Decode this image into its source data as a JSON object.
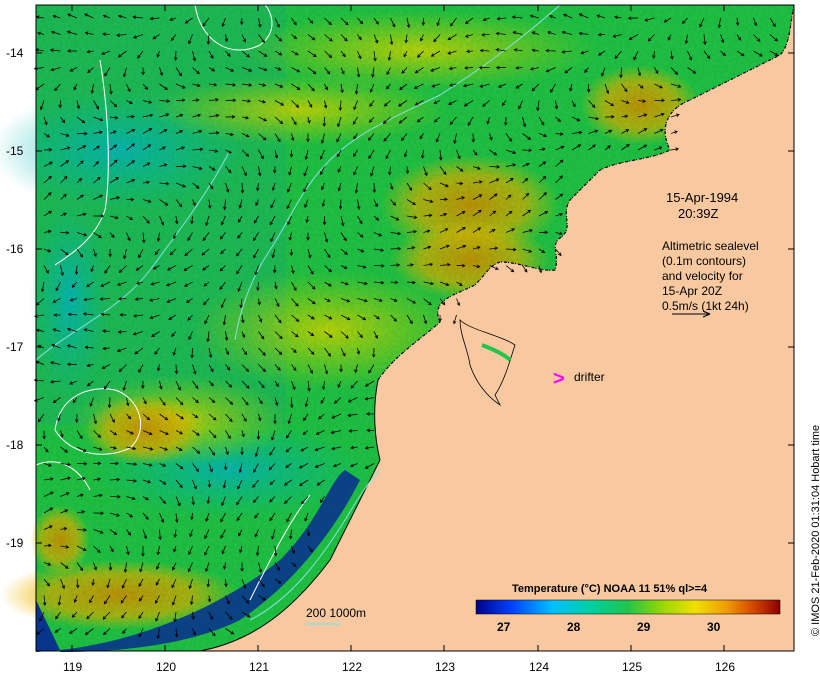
{
  "map": {
    "date": "15-Apr-1994",
    "time": "20:39Z",
    "legend_lines": [
      "Altimetric sealevel",
      "(0.1m contours)",
      "and velocity for",
      "15-Apr 20Z",
      "0.5m/s (1kt 24h)"
    ],
    "drifter_label": "drifter",
    "drifter_symbol": ">",
    "bathy_label": "200  1000m",
    "colorbar_title": "Temperature (°C) NOAA 11 51% ql>=4",
    "colorbar_ticks": [
      "27",
      "28",
      "29",
      "30"
    ],
    "credit": "© IMOS 21-Feb-2020 01:31:04 Hobart time",
    "lat_labels": [
      "-14",
      "-15",
      "-16",
      "-17",
      "-18",
      "-19"
    ],
    "lon_labels": [
      "119",
      "120",
      "121",
      "122",
      "123",
      "124",
      "125",
      "126"
    ],
    "colors": {
      "land": "#f8c9a0",
      "drifter": "#ff00ff",
      "contour": "#ffffff",
      "bathy": "#88e0e0",
      "sst_cold": "#00008b",
      "sst_mid": "#22c44a",
      "sst_warm": "#f0a000",
      "sst_hot": "#8b0000"
    }
  }
}
